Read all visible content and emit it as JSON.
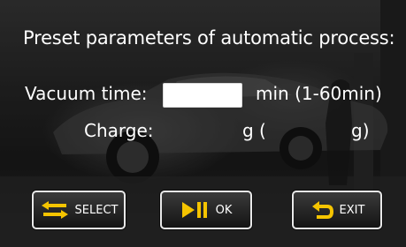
{
  "title": "Preset parameters of automatic process:",
  "vacuum": {
    "label": "Vacuum time:",
    "value": "",
    "unit": "min (1-60min)"
  },
  "charge": {
    "label": "Charge:",
    "unit_open": "g (",
    "value": "",
    "unit_close": "g)"
  },
  "buttons": {
    "select": {
      "label": "SELECT",
      "icon": "swap-arrows-icon"
    },
    "ok": {
      "label": "OK",
      "icon": "play-pause-icon"
    },
    "exit": {
      "label": "EXIT",
      "icon": "return-arrow-icon"
    }
  },
  "colors": {
    "icon": "#f5c400",
    "text": "#ffffff"
  }
}
